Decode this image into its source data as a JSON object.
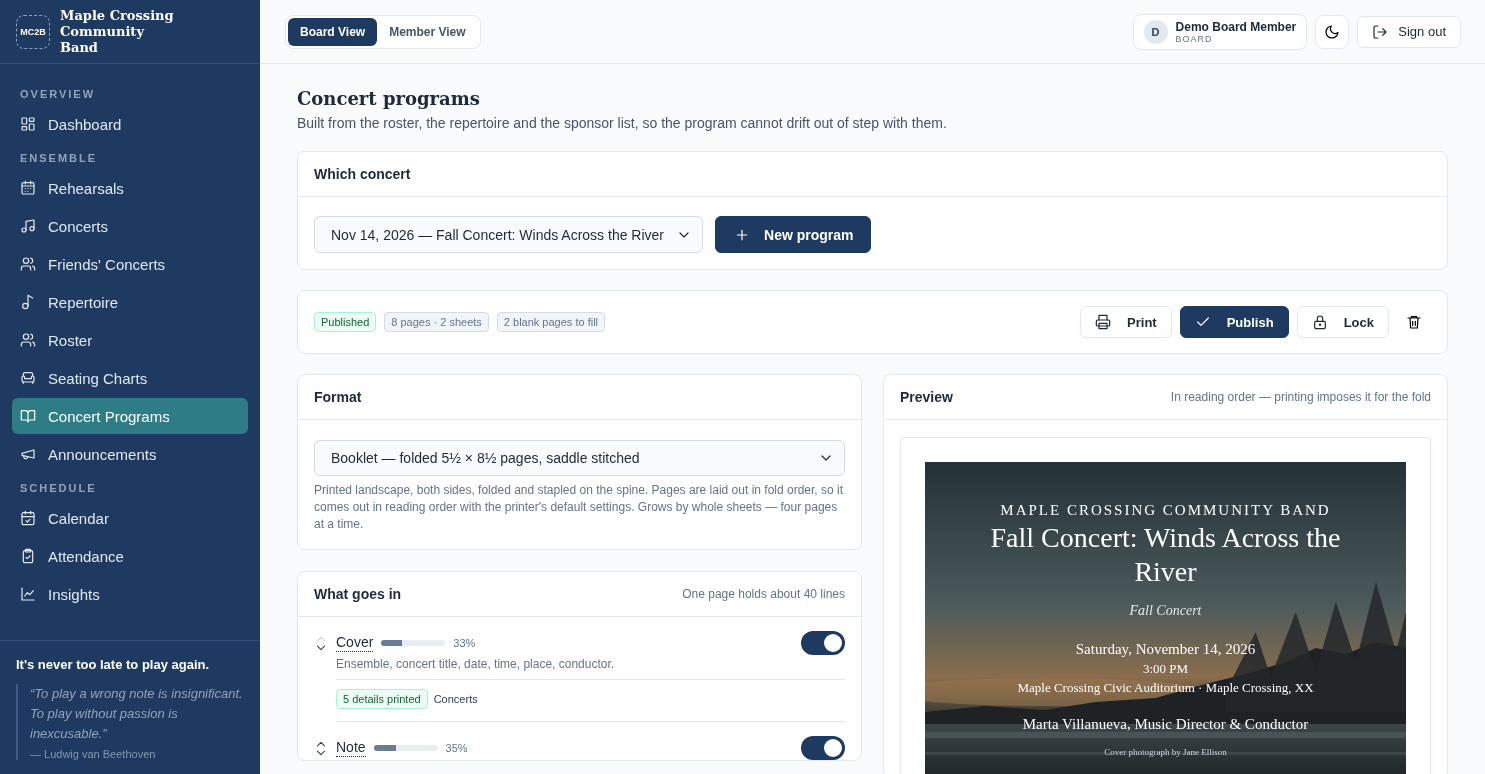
{
  "sidebar": {
    "brand": {
      "logo": "MC2B",
      "name": "Maple Crossing Community Band"
    },
    "sections": [
      {
        "heading": "OVERVIEW",
        "items": [
          {
            "label": "Dashboard",
            "selected": false
          }
        ]
      },
      {
        "heading": "ENSEMBLE",
        "items": [
          {
            "label": "Rehearsals",
            "selected": false
          },
          {
            "label": "Concerts",
            "selected": false
          },
          {
            "label": "Friends' Concerts",
            "selected": false
          },
          {
            "label": "Repertoire",
            "selected": false
          },
          {
            "label": "Roster",
            "selected": false
          },
          {
            "label": "Seating Charts",
            "selected": false
          },
          {
            "label": "Concert Programs",
            "selected": true
          },
          {
            "label": "Announcements",
            "selected": false
          }
        ]
      },
      {
        "heading": "SCHEDULE",
        "items": [
          {
            "label": "Calendar",
            "selected": false
          },
          {
            "label": "Attendance",
            "selected": false
          },
          {
            "label": "Insights",
            "selected": false
          }
        ]
      }
    ],
    "footer": {
      "tagline": "It's never too late to play again.",
      "quote": "“To play a wrong note is insignificant. To play without passion is inexcusable.”",
      "attribution": "— Ludwig van Beethoven"
    }
  },
  "topbar": {
    "views": [
      {
        "label": "Board View",
        "selected": true
      },
      {
        "label": "Member View",
        "selected": false
      }
    ],
    "user": {
      "initial": "D",
      "name": "Demo Board Member",
      "role": "BOARD"
    },
    "sign_out": "Sign out"
  },
  "page": {
    "title": "Concert programs",
    "subtitle": "Built from the roster, the repertoire and the sponsor list, so the program cannot drift out of step with them."
  },
  "concert_card": {
    "title": "Which concert",
    "selected_concert": "Nov 14, 2026 — Fall Concert: Winds Across the River",
    "new_button": "New program"
  },
  "status": {
    "badges": [
      {
        "label": "Published",
        "kind": "success"
      },
      {
        "label": "8 pages · 2 sheets",
        "kind": "neutral"
      },
      {
        "label": "2 blank pages to fill",
        "kind": "neutral"
      }
    ],
    "actions": [
      {
        "label": "Print",
        "kind": "outline"
      },
      {
        "label": "Publish",
        "kind": "primary"
      },
      {
        "label": "Lock",
        "kind": "outline"
      }
    ]
  },
  "format": {
    "title": "Format",
    "value": "Booklet — folded 5½ × 8½ pages, saddle stitched",
    "description": "Printed landscape, both sides, folded and stapled on the spine. Pages are laid out in fold order, so it comes out in reading order with the printer's default settings. Grows by whole sheets — four pages at a time."
  },
  "contents": {
    "title": "What goes in",
    "hint": "One page holds about 40 lines",
    "sections": [
      {
        "title": "Cover",
        "level": 0.33,
        "percent": "33%",
        "up_disabled": true,
        "on": true,
        "description": "Ensemble, concert title, date, time, place, conductor.",
        "tag": "5 details printed",
        "source": "Concerts"
      },
      {
        "title": "Note",
        "level": 0.35,
        "percent": "35%",
        "up_disabled": false,
        "on": true
      }
    ]
  },
  "preview": {
    "title": "Preview",
    "hint": "In reading order — printing imposes it for the fold",
    "cover": {
      "ensemble": "MAPLE CROSSING COMMUNITY BAND",
      "title": "Fall Concert: Winds Across the River",
      "subtitle": "Fall Concert",
      "date": "Saturday, November 14, 2026",
      "time": "3:00 PM",
      "venue": "Maple Crossing Civic Auditorium · Maple Crossing, XX",
      "conductor": "Marta Villanueva, Music Director & Conductor",
      "credit": "Cover photograph by Jane Ellison"
    }
  }
}
